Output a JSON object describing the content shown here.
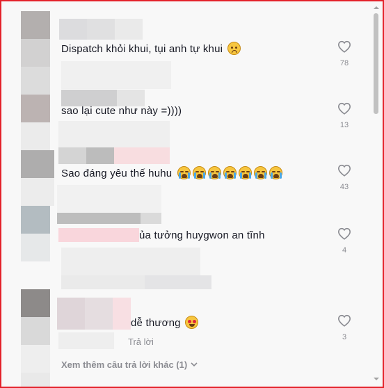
{
  "comments": [
    {
      "text": "Dispatch khỏi khui, tụi anh tự khui",
      "emoji": "worried-face",
      "likes": "78"
    },
    {
      "text": "sao lại cute như này =))))",
      "likes": "13"
    },
    {
      "text": "Sao đáng yêu thế huhu",
      "emoji": "loudly-crying-face",
      "emoji_count": 7,
      "likes": "43"
    },
    {
      "text": "ủa tưởng huygwon an tĩnh",
      "likes": "4"
    },
    {
      "text": "dễ thương",
      "emoji": "heart-eyes-face",
      "likes": "3"
    }
  ],
  "reply_label": "Trả lời",
  "more_replies_label": "Xem thêm câu trả lời khác (1)",
  "colors": {
    "frame_border": "#e3222b",
    "muted_text": "#8a8b91",
    "text": "#161823"
  }
}
